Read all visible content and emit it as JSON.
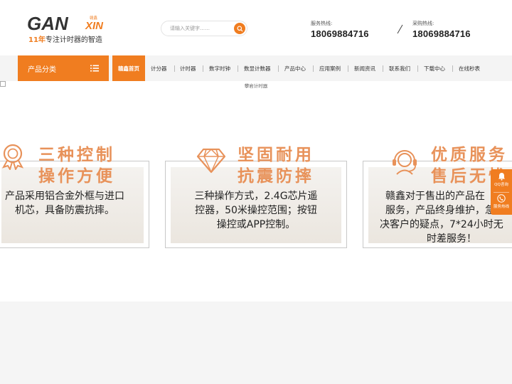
{
  "logo": {
    "brand_main": "GAN",
    "brand_tail": "XIN",
    "brand_cn": "赣鑫",
    "slogan_years": "11年",
    "slogan_text": "专注计时器的智造"
  },
  "search": {
    "placeholder": "请输入关键字……"
  },
  "hotlines": [
    {
      "label": "服务热线:",
      "number": "18069884716"
    },
    {
      "label": "采购热线:",
      "number": "18069884716"
    }
  ],
  "nav": {
    "category_label": "产品分类",
    "home_label": "赣鑫首页",
    "items": [
      "计分器",
      "计时器",
      "数字时钟",
      "数显计数器",
      "产品中心",
      "应用案例",
      "新闻资讯",
      "联系我们",
      "下载中心",
      "在线秒表"
    ]
  },
  "banner": {
    "alt_text": "攀岩计时器"
  },
  "features": [
    {
      "title_line1": "三种控制",
      "title_line2": "操作方便",
      "desc_lines": [
        "产品采用铝合金外框与进口",
        "机芯，具备防震抗摔。"
      ]
    },
    {
      "title_line1": "坚固耐用",
      "title_line2": "抗震防摔",
      "desc_lines": [
        "三种操作方式，2.4G芯片遥",
        "控器，50米操控范围；按钮",
        "操控或APP控制。"
      ]
    },
    {
      "title_line1": "优质服务",
      "title_line2": "售后无忧",
      "desc_lines": [
        "赣鑫对于售出的产品在",
        "服务，产品终身维护，急",
        "决客户的疑点，7*24小时无",
        "时差服务！"
      ]
    }
  ],
  "float_bar": {
    "qq_label": "QQ咨询",
    "phone_label": "服务热线"
  },
  "colors": {
    "accent": "#f07d20",
    "title": "#e8925a"
  }
}
